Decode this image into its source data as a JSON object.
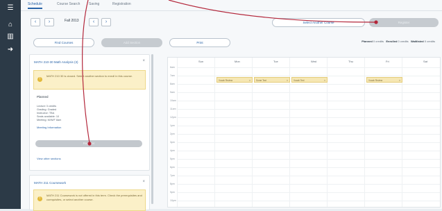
{
  "tabs": [
    {
      "label": "Schedule"
    },
    {
      "label": "Course Search"
    },
    {
      "label": "Saving"
    },
    {
      "label": "Registration"
    }
  ],
  "term": {
    "label": "Fall 2013"
  },
  "toolbar": {
    "primary_right_label": "Register",
    "secondary_right_label": "Select Another Course",
    "left_btn1": "Find Courses",
    "left_btn2": "Add Section",
    "left_btn3": "Print"
  },
  "filters": {
    "text1": "Planned",
    "text1_value": "0 credits",
    "text2": "Enrolled",
    "text2_value": "0 credits",
    "text3": "Waitlisted",
    "text3_value": "0 credits"
  },
  "left_panel": {
    "card1": {
      "title": "MATH 210-30 Math Analysis (3)",
      "warning": "MATH 210 30 is closed. Select another section to enroll in this course.",
      "section_label": "Planned",
      "details": [
        "Lecture 3 credits",
        "Grading: Graded",
        "Instructor: TBA",
        "Seats available: 10",
        "Meeting: M/W/F 8am"
      ],
      "link1": "Meeting Information",
      "button": "Register",
      "link2": "View other sections"
    },
    "card2": {
      "title": "MATH 211 Coursework",
      "warning": "MATH 211 Coursework is not offered in this term. Check the prerequisites and corequisites, or select another course."
    }
  },
  "calendar": {
    "days": [
      "Sun",
      "Mon",
      "Tue",
      "Wed",
      "Thu",
      "Fri",
      "Sat"
    ],
    "hours": [
      "6am",
      "7am",
      "8am",
      "9am",
      "10am",
      "11am",
      "12pm",
      "1pm",
      "2pm",
      "3pm",
      "4pm",
      "5pm",
      "6pm",
      "7pm",
      "8pm",
      "9pm",
      "10pm"
    ],
    "events": [
      {
        "label": "Vocab Review",
        "day": 1
      },
      {
        "label": "Some Text",
        "day": 2
      },
      {
        "label": "Vocab Text",
        "day": 3
      },
      {
        "label": "Vocab Review",
        "day": 5
      }
    ]
  },
  "colors": {
    "accent": "#2a64a8",
    "arrow": "#b3263a",
    "warning_bg": "#fbf0c8",
    "event_bg": "#f6e7b4"
  },
  "icons": [
    "menu-icon",
    "home-icon",
    "building-icon",
    "arrow-icon",
    "warning-icon",
    "close-icon",
    "chevron-left-icon",
    "chevron-right-icon",
    "print-icon"
  ]
}
